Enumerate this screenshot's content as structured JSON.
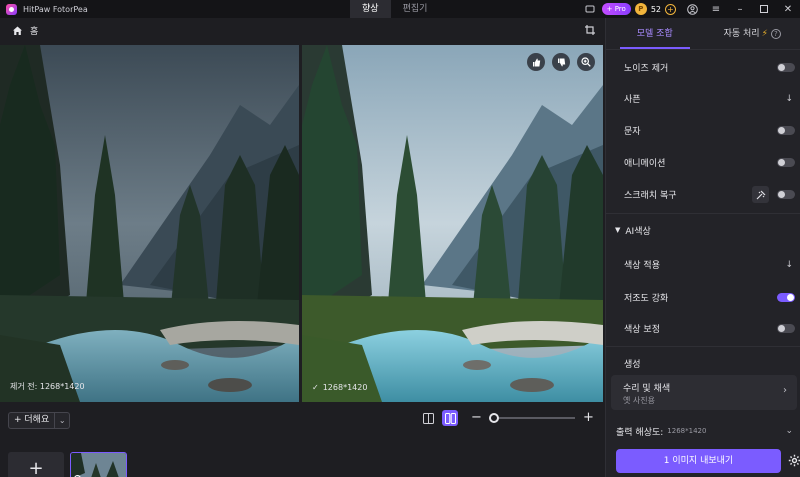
{
  "titlebar": {
    "app_name": "HitPaw FotorPea",
    "mode_tabs": [
      "향상",
      "편집기"
    ],
    "pro_label": "+ Pro",
    "coin_count": "52",
    "coin_symbol": "P"
  },
  "breadcrumb": {
    "home_label": "홈"
  },
  "canvas": {
    "before_label": "제거 전: 1268*1420",
    "after_label": "1268*1420"
  },
  "toolbar": {
    "add_label": "+ 더해요"
  },
  "side_tabs": {
    "model_tab": "모델 조합",
    "auto_tab": "자동 처리"
  },
  "options": [
    {
      "label": "노이즈 제거",
      "control": "toggle",
      "on": false
    },
    {
      "label": "사픈",
      "control": "download"
    },
    {
      "label": "문자",
      "control": "toggle",
      "on": false
    },
    {
      "label": "애니메이션",
      "control": "toggle",
      "on": false
    },
    {
      "label": "스크래치 복구",
      "control": "toggle",
      "on": false
    }
  ],
  "ai_color": {
    "title": "AI색상",
    "items": [
      {
        "label": "색상 적용",
        "control": "download"
      },
      {
        "label": "저조도 강화",
        "control": "toggle",
        "on": true
      },
      {
        "label": "색상 보정",
        "control": "toggle",
        "on": false
      }
    ]
  },
  "generate": {
    "title": "생성",
    "card_title": "수리 및 채색",
    "card_sub": "옛 사진용"
  },
  "output": {
    "label": "출력 해상도:",
    "value": "1268*1420"
  },
  "export_label": "1 이미지 내보내기",
  "colors": {
    "accent": "#7b5cff",
    "bg": "#1b1b1f",
    "panel": "#232328"
  }
}
